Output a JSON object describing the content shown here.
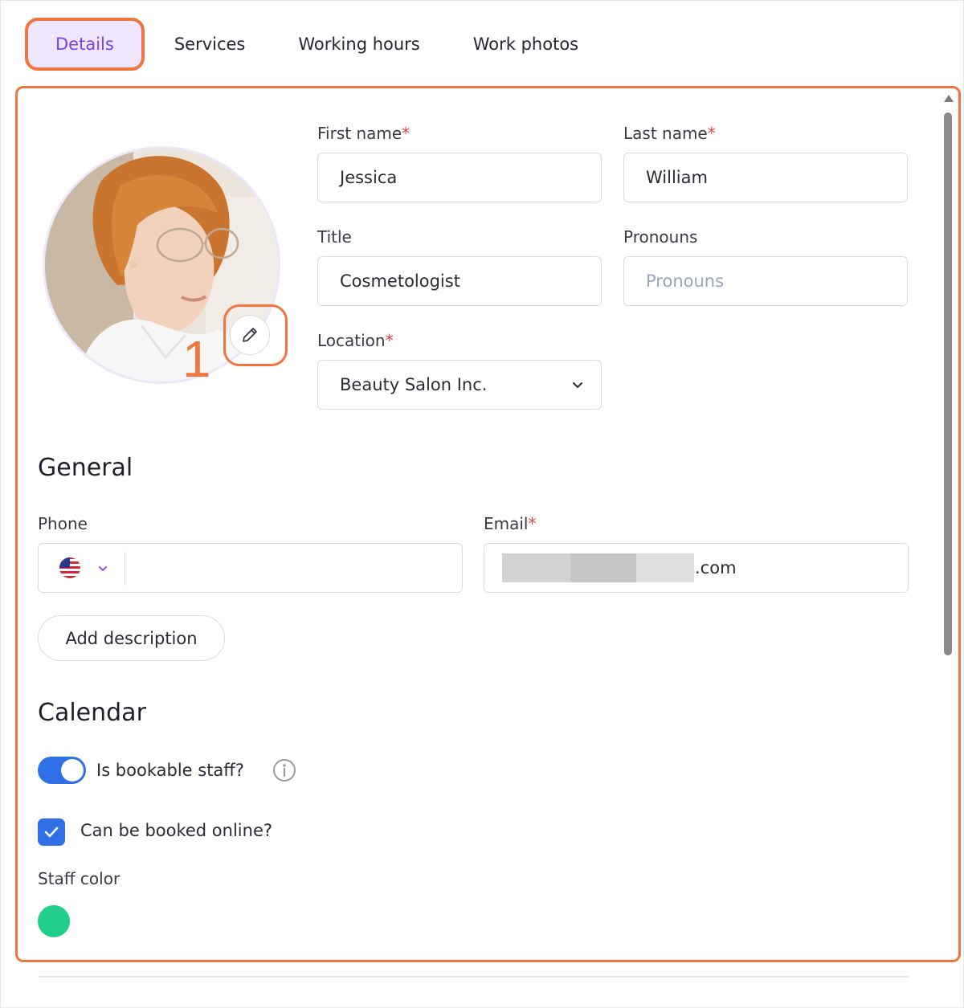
{
  "tabs": [
    {
      "label": "Details",
      "active": true
    },
    {
      "label": "Services",
      "active": false
    },
    {
      "label": "Working hours",
      "active": false
    },
    {
      "label": "Work photos",
      "active": false
    }
  ],
  "annotation": {
    "step": "1"
  },
  "form": {
    "first_name": {
      "label": "First name",
      "required_mark": "*",
      "value": "Jessica"
    },
    "last_name": {
      "label": "Last name",
      "required_mark": "*",
      "value": "William"
    },
    "title": {
      "label": "Title",
      "value": "Cosmetologist"
    },
    "pronouns": {
      "label": "Pronouns",
      "placeholder": "Pronouns"
    },
    "location": {
      "label": "Location",
      "required_mark": "*",
      "value": "Beauty Salon Inc."
    }
  },
  "general": {
    "heading": "General",
    "phone": {
      "label": "Phone",
      "country_flag": "us-flag-icon",
      "value": ""
    },
    "email": {
      "label": "Email",
      "required_mark": "*",
      "value_visible_suffix": ".com"
    },
    "add_description_label": "Add description"
  },
  "calendar": {
    "heading": "Calendar",
    "bookable_label": "Is bookable staff?",
    "bookable_on": true,
    "online_label": "Can be booked online?",
    "online_checked": true,
    "staff_color_label": "Staff color",
    "staff_color": "#1fcf8a"
  },
  "colors": {
    "accent_orange": "#f2743f",
    "tab_active_text": "#7b3ff2",
    "primary_blue": "#2f6fe8"
  }
}
